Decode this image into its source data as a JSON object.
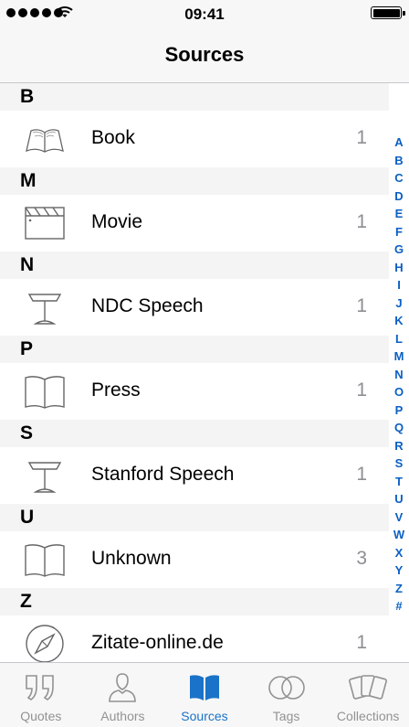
{
  "status_bar": {
    "time": "09:41"
  },
  "nav": {
    "title": "Sources"
  },
  "sections": [
    {
      "letter": "B",
      "item": {
        "label": "Book",
        "count": "1",
        "icon": "open-book-icon"
      }
    },
    {
      "letter": "M",
      "item": {
        "label": "Movie",
        "count": "1",
        "icon": "clapperboard-icon"
      }
    },
    {
      "letter": "N",
      "item": {
        "label": "NDC Speech",
        "count": "1",
        "icon": "lectern-icon"
      }
    },
    {
      "letter": "P",
      "item": {
        "label": "Press",
        "count": "1",
        "icon": "open-book-outline-icon"
      }
    },
    {
      "letter": "S",
      "item": {
        "label": "Stanford Speech",
        "count": "1",
        "icon": "lectern-icon"
      }
    },
    {
      "letter": "U",
      "item": {
        "label": "Unknown",
        "count": "3",
        "icon": "open-book-outline-icon"
      }
    },
    {
      "letter": "Z",
      "item": {
        "label": "Zitate-online.de",
        "count": "1",
        "icon": "compass-icon"
      }
    }
  ],
  "index": [
    "A",
    "B",
    "C",
    "D",
    "E",
    "F",
    "G",
    "H",
    "I",
    "J",
    "K",
    "L",
    "M",
    "N",
    "O",
    "P",
    "Q",
    "R",
    "S",
    "T",
    "U",
    "V",
    "W",
    "X",
    "Y",
    "Z",
    "#"
  ],
  "tabs": [
    {
      "label": "Quotes",
      "icon": "quote-marks-icon",
      "active": false
    },
    {
      "label": "Authors",
      "icon": "person-icon",
      "active": false
    },
    {
      "label": "Sources",
      "icon": "book-icon",
      "active": true
    },
    {
      "label": "Tags",
      "icon": "tags-circles-icon",
      "active": false
    },
    {
      "label": "Collections",
      "icon": "cards-icon",
      "active": false
    }
  ],
  "colors": {
    "accent": "#1a73c8",
    "index_color": "#0a5fc4",
    "inactive": "#929292"
  }
}
